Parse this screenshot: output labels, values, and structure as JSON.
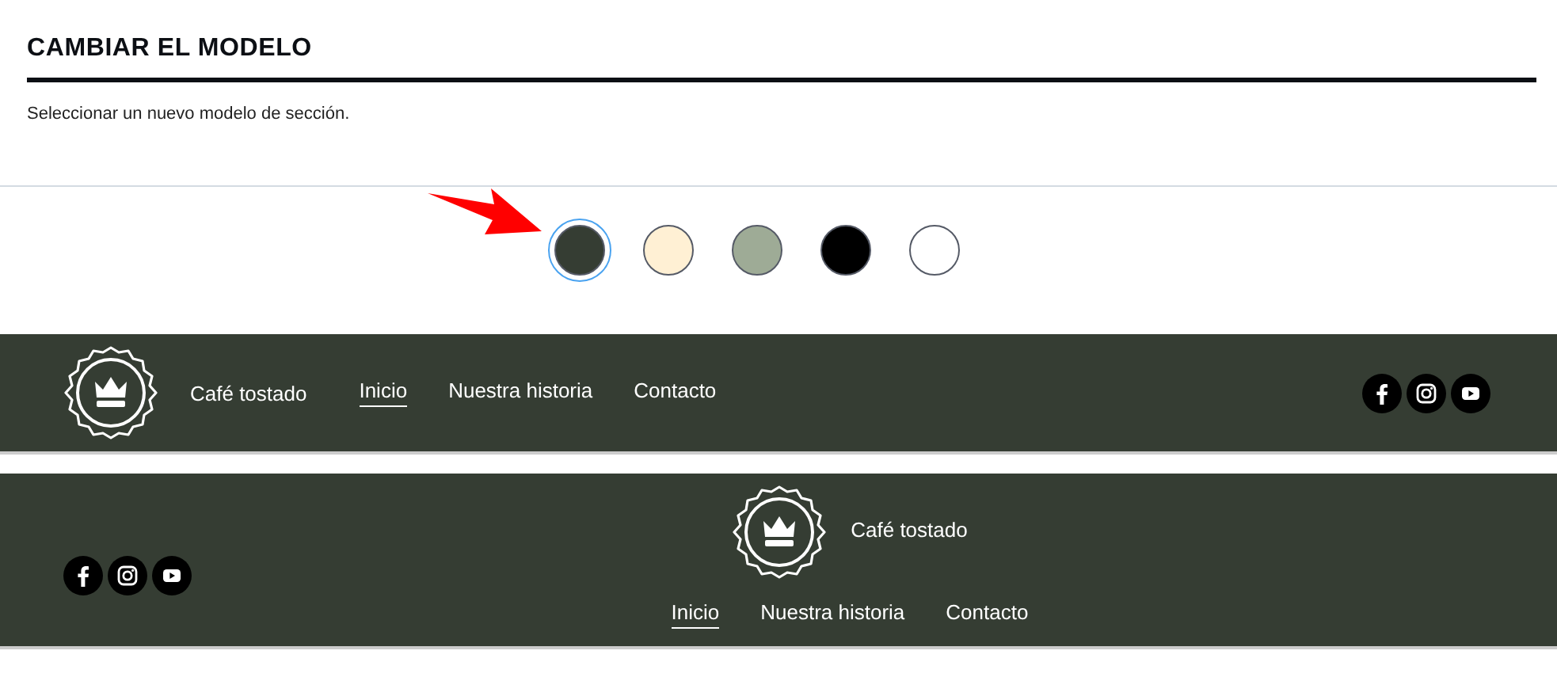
{
  "panel": {
    "title": "CAMBIAR EL MODELO",
    "description": "Seleccionar un nuevo modelo de sección."
  },
  "swatches": [
    {
      "color": "#353d33",
      "selected": true
    },
    {
      "color": "#fff0d4",
      "selected": false
    },
    {
      "color": "#9eab96",
      "selected": false
    },
    {
      "color": "#000000",
      "selected": false
    },
    {
      "color": "#ffffff",
      "selected": false
    }
  ],
  "footers": [
    {
      "kind": "inline",
      "brand": "Café tostado",
      "links": [
        {
          "label": "Inicio",
          "selected": true
        },
        {
          "label": "Nuestra historia",
          "selected": false
        },
        {
          "label": "Contacto",
          "selected": false
        }
      ]
    },
    {
      "kind": "centered",
      "brand": "Café tostado",
      "links": [
        {
          "label": "Inicio",
          "selected": true
        },
        {
          "label": "Nuestra historia",
          "selected": false
        },
        {
          "label": "Contacto",
          "selected": false
        }
      ]
    }
  ]
}
